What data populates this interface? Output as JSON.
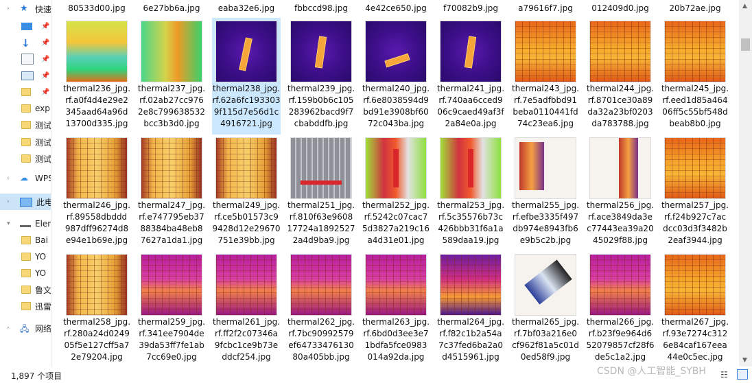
{
  "nav": {
    "items": [
      {
        "label": "快速",
        "type": "star"
      },
      {
        "label": "",
        "type": "desktop",
        "pinned": true
      },
      {
        "label": "",
        "type": "download",
        "pinned": true
      },
      {
        "label": "",
        "type": "document",
        "pinned": true
      },
      {
        "label": "",
        "type": "picture",
        "pinned": true
      },
      {
        "label": "",
        "type": "folder",
        "pinned": true
      },
      {
        "label": "exp",
        "type": "folder"
      },
      {
        "label": "测试",
        "type": "folder"
      },
      {
        "label": "测试",
        "type": "folder"
      },
      {
        "label": "测试",
        "type": "folder"
      },
      {
        "label": "WPS",
        "type": "cloud"
      },
      {
        "label": "此电",
        "type": "pc"
      },
      {
        "label": "Elem",
        "type": "drive"
      },
      {
        "label": "Bai",
        "type": "folder"
      },
      {
        "label": "YO",
        "type": "folder"
      },
      {
        "label": "YO",
        "type": "folder"
      },
      {
        "label": "鲁文",
        "type": "folder"
      },
      {
        "label": "迅雷",
        "type": "folder"
      },
      {
        "label": "网络",
        "type": "network"
      }
    ]
  },
  "top_row": [
    "80533d00.jpg",
    "6e27bb6a.jpg",
    "eaba32e6.jpg",
    "fbbccd98.jpg",
    "4e42ce650.jpg",
    "f70082b9.jpg",
    "a79616f7.jpg",
    "012409d0.jpg",
    "20b72ae.jpg"
  ],
  "rows": [
    [
      {
        "l1": "thermal236_jpg.",
        "l2": "rf.a0f4d4e29e2",
        "l3": "345aad64a96d",
        "l4": "13700d335.jpg",
        "style": "green"
      },
      {
        "l1": "thermal237_jpg.",
        "l2": "rf.02ab27cc976",
        "l3": "2e8c799638532",
        "l4": "bcc3b3d0.jpg",
        "style": "green2"
      },
      {
        "l1": "thermal238_jpg.",
        "l2": "rf.62a6fc193303",
        "l3": "9f115d7e56d1c",
        "l4": "4916721.jpg",
        "style": "purple",
        "selected": true
      },
      {
        "l1": "thermal239_jpg.",
        "l2": "rf.159b0b6c105",
        "l3": "283962bacd9f7",
        "l4": "cbabddfb.jpg",
        "style": "purple"
      },
      {
        "l1": "thermal240_jpg.",
        "l2": "rf.6e8038594d9",
        "l3": "bd91e3908bf60",
        "l4": "72c043ba.jpg",
        "style": "purple"
      },
      {
        "l1": "thermal241_jpg.",
        "l2": "rf.740aa6cced9",
        "l3": "06c9caed49af3f",
        "l4": "2a84e0a.jpg",
        "style": "purple"
      },
      {
        "l1": "thermal243_jpg.",
        "l2": "rf.7e5adfbbd91",
        "l3": "beba0110441fd",
        "l4": "74c23ea6.jpg",
        "style": "orange"
      },
      {
        "l1": "thermal244_jpg.",
        "l2": "rf.8701ce30a89",
        "l3": "da32a23bf0203",
        "l4": "da783788.jpg",
        "style": "orange"
      },
      {
        "l1": "thermal245_jpg.",
        "l2": "rf.eed1d85a464",
        "l3": "06ff5c55bf548d",
        "l4": "beab8b0.jpg",
        "style": "orange"
      }
    ],
    [
      {
        "l1": "thermal246_jpg.",
        "l2": "rf.89558dbddd",
        "l3": "987dff96274d8",
        "l4": "e94e1b69e.jpg",
        "style": "orange2"
      },
      {
        "l1": "thermal247_jpg.",
        "l2": "rf.e747795eb37",
        "l3": "88384ba48eb8",
        "l4": "7627a1da1.jpg",
        "style": "orange2"
      },
      {
        "l1": "thermal249_jpg.",
        "l2": "rf.ce5b01573c9",
        "l3": "9428d12e29670",
        "l4": "751e39bb.jpg",
        "style": "orange2"
      },
      {
        "l1": "thermal251_jpg.",
        "l2": "rf.810f63e9608",
        "l3": "17724a1892527",
        "l4": "2a4d9ba9.jpg",
        "style": "gray"
      },
      {
        "l1": "thermal252_jpg.",
        "l2": "rf.5242c07cac7",
        "l3": "5d3827a219c16",
        "l4": "a4d31e01.jpg",
        "style": "mixed"
      },
      {
        "l1": "thermal253_jpg.",
        "l2": "rf.5c35576b73c",
        "l3": "426bbb31f6a1a",
        "l4": "589daa19.jpg",
        "style": "mixed"
      },
      {
        "l1": "thermal255_jpg.",
        "l2": "rf.efbe3335f497",
        "l3": "db974e8943fb6",
        "l4": "e9b5c2b.jpg",
        "style": "white"
      },
      {
        "l1": "thermal256_jpg.",
        "l2": "rf.ace3849da3e",
        "l3": "c77443ea39a20",
        "l4": "45029f88.jpg",
        "style": "white"
      },
      {
        "l1": "thermal257_jpg.",
        "l2": "rf.f24b927c7ac",
        "l3": "dcc03d3f3482b",
        "l4": "2eaf3944.jpg",
        "style": "orange"
      }
    ],
    [
      {
        "l1": "thermal258_jpg.",
        "l2": "rf.280a24d0249",
        "l3": "05f5e127cff5a7",
        "l4": "2e79204.jpg",
        "style": "orange2"
      },
      {
        "l1": "thermal259_jpg.",
        "l2": "rf.341ee7904de",
        "l3": "39da53ff7fe1ab",
        "l4": "7cc69e0.jpg",
        "style": "magenta"
      },
      {
        "l1": "thermal261_jpg.",
        "l2": "rf.ff2f2c07346a",
        "l3": "9fcbc1ce9b73e",
        "l4": "ddcf254.jpg",
        "style": "magenta"
      },
      {
        "l1": "thermal262_jpg.",
        "l2": "rf.7bc90992579",
        "l3": "ef64733476130",
        "l4": "80a405bb.jpg",
        "style": "magenta"
      },
      {
        "l1": "thermal263_jpg.",
        "l2": "rf.6bd0d3ee3e7",
        "l3": "1bdfa5fce0983",
        "l4": "014a92da.jpg",
        "style": "magenta"
      },
      {
        "l1": "thermal264_jpg.",
        "l2": "rf.f82c1b2a54a",
        "l3": "7c37fed6ba2a0",
        "l4": "d4515961.jpg",
        "style": "purpleorange"
      },
      {
        "l1": "thermal265_jpg.",
        "l2": "rf.7bf03a216e0",
        "l3": "cf962f81a5c01d",
        "l4": "0ed58f9.jpg",
        "style": "white"
      },
      {
        "l1": "thermal266_jpg.",
        "l2": "rf.b23f9e964d6",
        "l3": "52079857cf28f6",
        "l4": "de5c1a2.jpg",
        "style": "magenta"
      },
      {
        "l1": "thermal267_jpg.",
        "l2": "rf.93e7274c312",
        "l3": "6e84caf167eea",
        "l4": "44e0c5ec.jpg",
        "style": "orange"
      }
    ]
  ],
  "status": {
    "count": "1,897 个项目"
  },
  "watermark": "CSDN @人工智能_SYBH"
}
